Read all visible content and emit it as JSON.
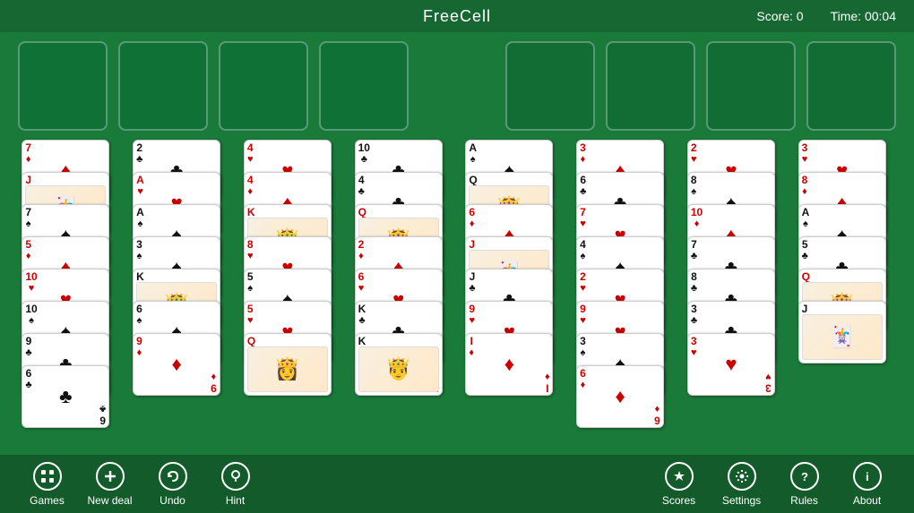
{
  "header": {
    "title": "FreeCell",
    "score_label": "Score:",
    "score_value": "0",
    "time_label": "Time:",
    "time_value": "00:04"
  },
  "toolbar": {
    "left_buttons": [
      {
        "id": "games",
        "label": "Games",
        "icon": "grid"
      },
      {
        "id": "new-deal",
        "label": "New deal",
        "icon": "plus"
      },
      {
        "id": "undo",
        "label": "Undo",
        "icon": "undo"
      },
      {
        "id": "hint",
        "label": "Hint",
        "icon": "bulb"
      }
    ],
    "right_buttons": [
      {
        "id": "scores",
        "label": "Scores",
        "icon": "crown"
      },
      {
        "id": "settings",
        "label": "Settings",
        "icon": "gear"
      },
      {
        "id": "rules",
        "label": "Rules",
        "icon": "question"
      },
      {
        "id": "about",
        "label": "About",
        "icon": "info"
      }
    ]
  },
  "columns": [
    {
      "cards": [
        {
          "rank": "7",
          "suit": "♦",
          "color": "red",
          "face": false
        },
        {
          "rank": "J",
          "suit": "♦",
          "color": "red",
          "face": true
        },
        {
          "rank": "7",
          "suit": "♠",
          "color": "black",
          "face": false
        },
        {
          "rank": "5",
          "suit": "♦",
          "color": "red",
          "face": false
        },
        {
          "rank": "10",
          "suit": "♥",
          "color": "red",
          "face": false
        },
        {
          "rank": "10",
          "suit": "♠",
          "color": "black",
          "face": false
        },
        {
          "rank": "9",
          "suit": "♣",
          "color": "black",
          "face": false
        },
        {
          "rank": "6",
          "suit": "♣",
          "color": "black",
          "face": false
        }
      ]
    },
    {
      "cards": [
        {
          "rank": "2",
          "suit": "♣",
          "color": "black",
          "face": false
        },
        {
          "rank": "A",
          "suit": "♥",
          "color": "red",
          "face": false
        },
        {
          "rank": "A",
          "suit": "♠",
          "color": "black",
          "face": false
        },
        {
          "rank": "3",
          "suit": "♠",
          "color": "black",
          "face": false
        },
        {
          "rank": "K",
          "suit": "♠",
          "color": "black",
          "face": true
        },
        {
          "rank": "6",
          "suit": "♠",
          "color": "black",
          "face": false
        },
        {
          "rank": "9",
          "suit": "♦",
          "color": "red",
          "face": false
        }
      ]
    },
    {
      "cards": [
        {
          "rank": "4",
          "suit": "♥",
          "color": "red",
          "face": false
        },
        {
          "rank": "4",
          "suit": "♦",
          "color": "red",
          "face": false
        },
        {
          "rank": "K",
          "suit": "♥",
          "color": "red",
          "face": true
        },
        {
          "rank": "8",
          "suit": "♥",
          "color": "red",
          "face": false
        },
        {
          "rank": "5",
          "suit": "♠",
          "color": "black",
          "face": false
        },
        {
          "rank": "5",
          "suit": "♥",
          "color": "red",
          "face": false
        },
        {
          "rank": "Q",
          "suit": "♦",
          "color": "red",
          "face": true
        }
      ]
    },
    {
      "cards": [
        {
          "rank": "10",
          "suit": "♣",
          "color": "black",
          "face": false
        },
        {
          "rank": "4",
          "suit": "♣",
          "color": "black",
          "face": false
        },
        {
          "rank": "Q",
          "suit": "♥",
          "color": "red",
          "face": true
        },
        {
          "rank": "2",
          "suit": "♦",
          "color": "red",
          "face": false
        },
        {
          "rank": "6",
          "suit": "♥",
          "color": "red",
          "face": false
        },
        {
          "rank": "K",
          "suit": "♣",
          "color": "black",
          "face": false
        },
        {
          "rank": "K",
          "suit": "♠",
          "color": "black",
          "face": true
        }
      ]
    },
    {
      "cards": [
        {
          "rank": "A",
          "suit": "♠",
          "color": "black",
          "face": false
        },
        {
          "rank": "Q",
          "suit": "♠",
          "color": "black",
          "face": true
        },
        {
          "rank": "6",
          "suit": "♦",
          "color": "red",
          "face": false
        },
        {
          "rank": "J",
          "suit": "♥",
          "color": "red",
          "face": true
        },
        {
          "rank": "J",
          "suit": "♣",
          "color": "black",
          "face": false
        },
        {
          "rank": "9",
          "suit": "♥",
          "color": "red",
          "face": false
        },
        {
          "rank": "I",
          "suit": "♦",
          "color": "red",
          "face": false
        }
      ]
    },
    {
      "cards": [
        {
          "rank": "3",
          "suit": "♦",
          "color": "red",
          "face": false
        },
        {
          "rank": "6",
          "suit": "♣",
          "color": "black",
          "face": false
        },
        {
          "rank": "7",
          "suit": "♥",
          "color": "red",
          "face": false
        },
        {
          "rank": "4",
          "suit": "♠",
          "color": "black",
          "face": false
        },
        {
          "rank": "2",
          "suit": "♥",
          "color": "red",
          "face": false
        },
        {
          "rank": "9",
          "suit": "♥",
          "color": "red",
          "face": false
        },
        {
          "rank": "3",
          "suit": "♠",
          "color": "black",
          "face": false
        },
        {
          "rank": "6",
          "suit": "♦",
          "color": "red",
          "face": false
        }
      ]
    },
    {
      "cards": [
        {
          "rank": "2",
          "suit": "♥",
          "color": "red",
          "face": false
        },
        {
          "rank": "8",
          "suit": "♠",
          "color": "black",
          "face": false
        },
        {
          "rank": "10",
          "suit": "♦",
          "color": "red",
          "face": false
        },
        {
          "rank": "7",
          "suit": "♣",
          "color": "black",
          "face": false
        },
        {
          "rank": "8",
          "suit": "♣",
          "color": "black",
          "face": false
        },
        {
          "rank": "3",
          "suit": "♣",
          "color": "black",
          "face": false
        },
        {
          "rank": "3",
          "suit": "♥",
          "color": "red",
          "face": false
        }
      ]
    },
    {
      "cards": [
        {
          "rank": "3",
          "suit": "♥",
          "color": "red",
          "face": false
        },
        {
          "rank": "8",
          "suit": "♦",
          "color": "red",
          "face": false
        },
        {
          "rank": "A",
          "suit": "♠",
          "color": "black",
          "face": false
        },
        {
          "rank": "5",
          "suit": "♣",
          "color": "black",
          "face": false
        },
        {
          "rank": "Q",
          "suit": "♥",
          "color": "red",
          "face": true
        },
        {
          "rank": "J",
          "suit": "♠",
          "color": "black",
          "face": true
        }
      ]
    }
  ]
}
